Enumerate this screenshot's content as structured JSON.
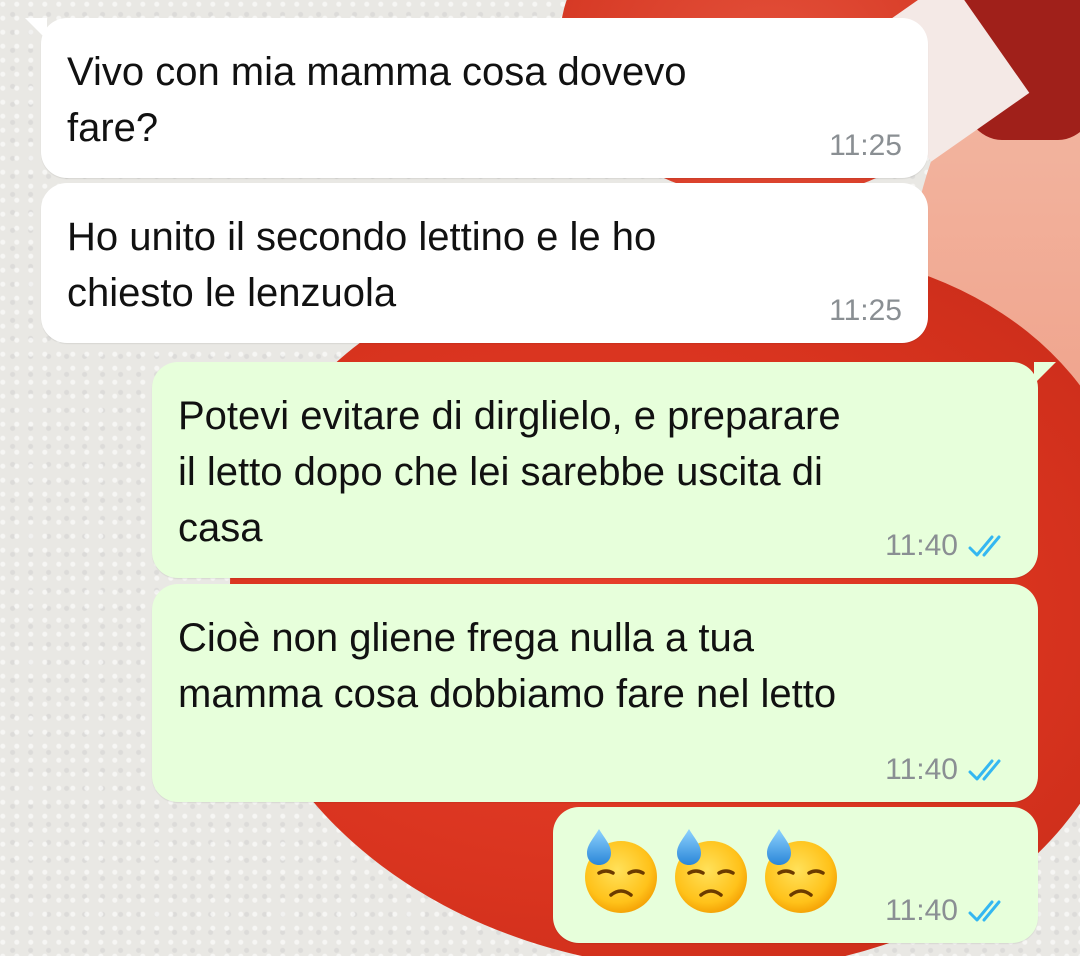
{
  "chat": {
    "messages": [
      {
        "direction": "incoming",
        "text": "Vivo con mia mamma cosa dovevo\nfare?",
        "time": "11:25"
      },
      {
        "direction": "incoming",
        "text": "Ho unito il secondo lettino e le ho\nchiesto le lenzuola",
        "time": "11:25"
      },
      {
        "direction": "outgoing",
        "text": "Potevi evitare di dirglielo, e preparare\nil letto dopo che lei sarebbe uscita di\ncasa",
        "time": "11:40",
        "status_icon": "double-check-read-icon"
      },
      {
        "direction": "outgoing",
        "text": "Cioè non gliene frega nulla a tua\nmamma cosa dobbiamo fare nel letto",
        "time": "11:40",
        "status_icon": "double-check-read-icon"
      },
      {
        "direction": "outgoing",
        "emoji": [
          "😓",
          "😓",
          "😓"
        ],
        "emoji_icon": "downcast-face-with-sweat-icon",
        "time": "11:40",
        "status_icon": "double-check-read-icon"
      }
    ]
  },
  "colors": {
    "incoming_bubble": "#ffffff",
    "outgoing_bubble": "#e7ffdb",
    "timestamp": "#8a8f93",
    "read_ticks": "#34b7f1"
  }
}
